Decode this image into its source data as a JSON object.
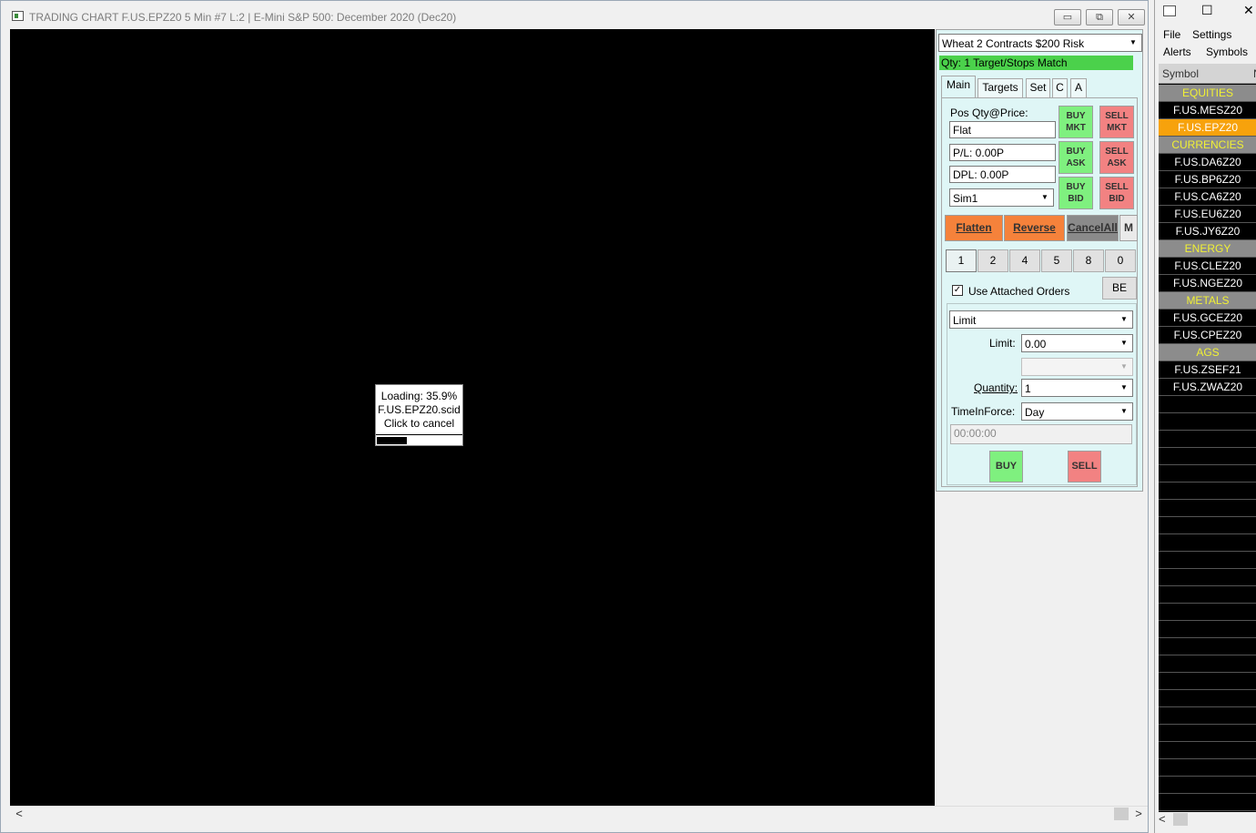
{
  "chart_window": {
    "title": "TRADING CHART  F.US.EPZ20  5 Min   #7  L:2 | E-Mini S&P 500: December 2020 (Dec20)",
    "minimize_glyph": "▭",
    "restore_glyph": "⧉",
    "close_glyph": "✕"
  },
  "loading": {
    "line1": "Loading: 35.9%",
    "line2": "F.US.EPZ20.scid",
    "line3": "Click to cancel",
    "progress": 0.359
  },
  "scroll": {
    "left_arrow": "<",
    "right_arrow": ">"
  },
  "trade_panel": {
    "config_select": "Wheat 2 Contracts $200 Risk",
    "qty_status": "Qty: 1 Target/Stops Match",
    "tabs": [
      "Main",
      "Targets",
      "Set",
      "C",
      "A"
    ],
    "pos_label": "Pos Qty@Price:",
    "pos_value": "Flat",
    "pl_value": "P/L: 0.00P",
    "dpl_value": "DPL: 0.00P",
    "account_select": "Sim1",
    "buy_mkt": [
      "BUY",
      "MKT"
    ],
    "sell_mkt": [
      "SELL",
      "MKT"
    ],
    "buy_ask": [
      "BUY",
      "ASK"
    ],
    "sell_ask": [
      "SELL",
      "ASK"
    ],
    "buy_bid": [
      "BUY",
      "BID"
    ],
    "sell_bid": [
      "SELL",
      "BID"
    ],
    "flatten": "Flatten",
    "reverse": "Reverse",
    "cancel_all": "CancelAll",
    "m_button": "M",
    "qty_buttons": [
      "1",
      "2",
      "4",
      "5",
      "8",
      "0"
    ],
    "use_attached_orders": "Use Attached Orders",
    "use_attached_checked": "✓",
    "be_button": "BE",
    "order_type": "Limit",
    "limit_label": "Limit:",
    "limit_value": "0.00",
    "quantity_label": "Quantity:",
    "quantity_value": "1",
    "tif_label": "TimeInForce:",
    "tif_value": "Day",
    "time_placeholder": "00:00:00",
    "buy": "BUY",
    "sell": "SELL",
    "dropdown_glyph": "▼"
  },
  "symbol_window": {
    "window_controls": [
      "☐",
      "✕"
    ],
    "menu": [
      "File",
      "Settings",
      "Alerts",
      "Symbols"
    ],
    "header": "Symbol",
    "header2": "N",
    "rows": [
      {
        "type": "cat",
        "text": "EQUITIES"
      },
      {
        "type": "sym",
        "text": "F.US.MESZ20"
      },
      {
        "type": "sel",
        "text": "F.US.EPZ20"
      },
      {
        "type": "cat",
        "text": "CURRENCIES"
      },
      {
        "type": "sym",
        "text": "F.US.DA6Z20"
      },
      {
        "type": "sym",
        "text": "F.US.BP6Z20"
      },
      {
        "type": "sym",
        "text": "F.US.CA6Z20"
      },
      {
        "type": "sym",
        "text": "F.US.EU6Z20"
      },
      {
        "type": "sym",
        "text": "F.US.JY6Z20"
      },
      {
        "type": "cat",
        "text": "ENERGY"
      },
      {
        "type": "sym",
        "text": "F.US.CLEZ20"
      },
      {
        "type": "sym",
        "text": "F.US.NGEZ20"
      },
      {
        "type": "cat",
        "text": "METALS"
      },
      {
        "type": "sym",
        "text": "F.US.GCEZ20"
      },
      {
        "type": "sym",
        "text": "F.US.CPEZ20"
      },
      {
        "type": "cat",
        "text": "AGS"
      },
      {
        "type": "sym",
        "text": "F.US.ZSEF21"
      },
      {
        "type": "sym",
        "text": "F.US.ZWAZ20"
      }
    ]
  }
}
